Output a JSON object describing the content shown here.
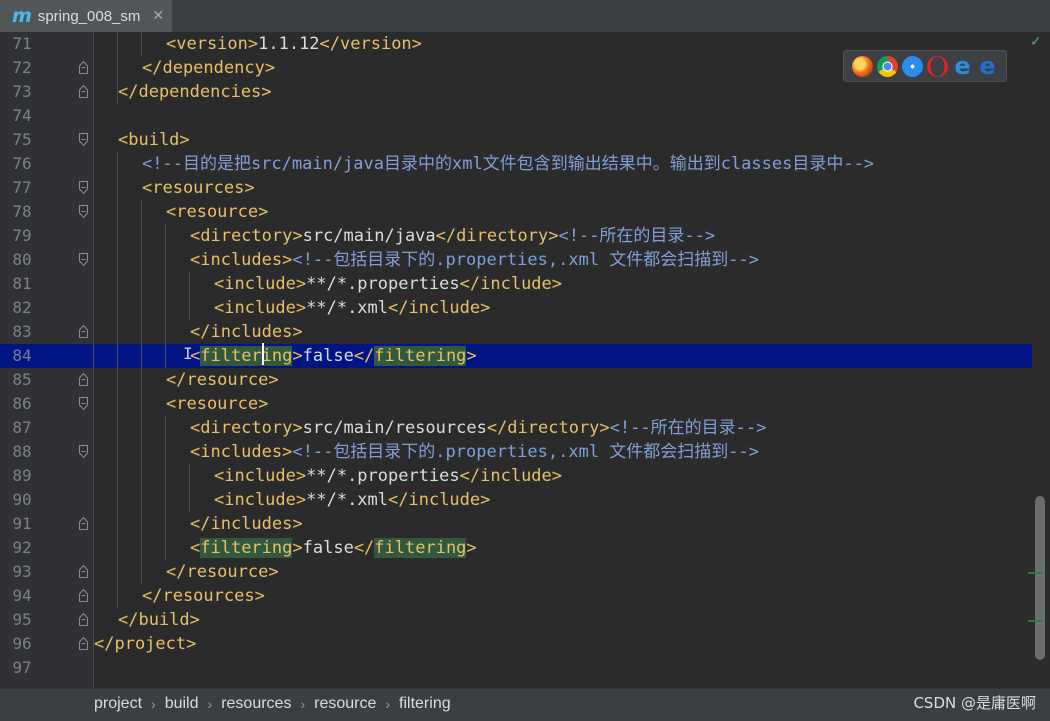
{
  "tab": {
    "icon": "m",
    "label": "spring_008_sm",
    "close": "✕"
  },
  "lines": [
    {
      "n": "71",
      "t": [
        [
          "t",
          "<version>"
        ],
        [
          "tx",
          "1.1.12"
        ],
        [
          "t",
          "</version>"
        ]
      ]
    },
    {
      "n": "72",
      "t": [
        [
          "t",
          "</dependency>"
        ]
      ]
    },
    {
      "n": "73",
      "t": [
        [
          "t",
          "</dependencies>"
        ]
      ]
    },
    {
      "n": "74",
      "t": []
    },
    {
      "n": "75",
      "t": [
        [
          "t",
          "<build>"
        ]
      ]
    },
    {
      "n": "76",
      "t": [
        [
          "cm2",
          "<!--目的是把src/main/java目录中的xml文件包含到输出结果中。输出到classes目录中-->"
        ]
      ]
    },
    {
      "n": "77",
      "t": [
        [
          "t",
          "<resources>"
        ]
      ]
    },
    {
      "n": "78",
      "t": [
        [
          "t",
          "<resource>"
        ]
      ]
    },
    {
      "n": "79",
      "t": [
        [
          "t",
          "<directory>"
        ],
        [
          "tx",
          "src/main/java"
        ],
        [
          "t",
          "</directory>"
        ],
        [
          "cm2",
          "<!--所在的目录-->"
        ]
      ]
    },
    {
      "n": "80",
      "t": [
        [
          "t",
          "<includes>"
        ],
        [
          "cm2",
          "<!--包括目录下的.properties,.xml 文件都会扫描到-->"
        ]
      ]
    },
    {
      "n": "81",
      "t": [
        [
          "t",
          "<include>"
        ],
        [
          "tx",
          "**/*.properties"
        ],
        [
          "t",
          "</include>"
        ]
      ]
    },
    {
      "n": "82",
      "t": [
        [
          "t",
          "<include>"
        ],
        [
          "tx",
          "**/*.xml"
        ],
        [
          "t",
          "</include>"
        ]
      ]
    },
    {
      "n": "83",
      "t": [
        [
          "t",
          "</includes>"
        ]
      ]
    },
    {
      "n": "84",
      "t": [
        [
          "t",
          "<"
        ],
        [
          "hl",
          "filtering"
        ],
        [
          "t",
          ">"
        ],
        [
          "tx",
          "false"
        ],
        [
          "t",
          "</"
        ],
        [
          "hl",
          "filtering"
        ],
        [
          "t",
          ">"
        ]
      ]
    },
    {
      "n": "85",
      "t": [
        [
          "t",
          "</resource>"
        ]
      ]
    },
    {
      "n": "86",
      "t": [
        [
          "t",
          "<resource>"
        ]
      ]
    },
    {
      "n": "87",
      "t": [
        [
          "t",
          "<directory>"
        ],
        [
          "tx",
          "src/main/resources"
        ],
        [
          "t",
          "</directory>"
        ],
        [
          "cm2",
          "<!--所在的目录-->"
        ]
      ]
    },
    {
      "n": "88",
      "t": [
        [
          "t",
          "<includes>"
        ],
        [
          "cm2",
          "<!--包括目录下的.properties,.xml 文件都会扫描到-->"
        ]
      ]
    },
    {
      "n": "89",
      "t": [
        [
          "t",
          "<include>"
        ],
        [
          "tx",
          "**/*.properties"
        ],
        [
          "t",
          "</include>"
        ]
      ]
    },
    {
      "n": "90",
      "t": [
        [
          "t",
          "<include>"
        ],
        [
          "tx",
          "**/*.xml"
        ],
        [
          "t",
          "</include>"
        ]
      ]
    },
    {
      "n": "91",
      "t": [
        [
          "t",
          "</includes>"
        ]
      ]
    },
    {
      "n": "92",
      "t": [
        [
          "t",
          "<"
        ],
        [
          "hl",
          "filtering"
        ],
        [
          "t",
          ">"
        ],
        [
          "tx",
          "false"
        ],
        [
          "t",
          "</"
        ],
        [
          "hl",
          "filtering"
        ],
        [
          "t",
          ">"
        ]
      ]
    },
    {
      "n": "93",
      "t": [
        [
          "t",
          "</resource>"
        ]
      ]
    },
    {
      "n": "94",
      "t": [
        [
          "t",
          "</resources>"
        ]
      ]
    },
    {
      "n": "95",
      "t": [
        [
          "t",
          "</build>"
        ]
      ]
    },
    {
      "n": "96",
      "t": [
        [
          "t",
          "</project>"
        ]
      ]
    },
    {
      "n": "97",
      "t": []
    }
  ],
  "breadcrumb": [
    "project",
    "build",
    "resources",
    "resource",
    "filtering"
  ],
  "breadcrumb_sep": "›",
  "watermark": "CSDN @是庸医啊",
  "inspection_status": "✓",
  "browser_icons": [
    "firefox-icon",
    "chrome-icon",
    "safari-icon",
    "opera-icon",
    "ie-icon",
    "edge-icon"
  ],
  "colors": {
    "tag": "#e8bf6a",
    "comment": "#7f9fd8",
    "text": "#dcdcdc",
    "current_line": "#001583",
    "match_highlight": "#32593d"
  }
}
